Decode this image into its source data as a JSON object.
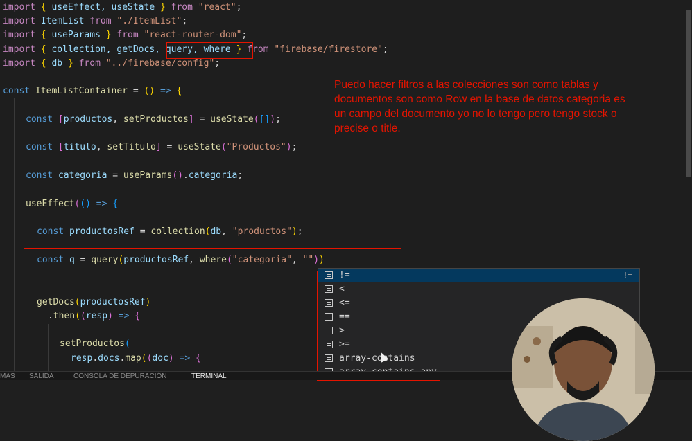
{
  "code": {
    "l1": {
      "kw_import": "import",
      "b_open": "{",
      "names": " useEffect, useState ",
      "b_close": "}",
      "kw_from": "from",
      "src": "\"react\"",
      "semi": ";"
    },
    "l2": {
      "kw_import": "import",
      "name": "ItemList",
      "kw_from": "from",
      "src": "\"./ItemList\"",
      "semi": ";"
    },
    "l3": {
      "kw_import": "import",
      "b_open": "{",
      "names": " useParams ",
      "b_close": "}",
      "kw_from": "from",
      "src": "\"react-router-dom\"",
      "semi": ";"
    },
    "l4": {
      "kw_import": "import",
      "b_open": "{",
      "names_a": " collection, getDocs, ",
      "names_b": "query, where ",
      "b_close": "}",
      "kw_from": "from",
      "src": "\"firebase/firestore\"",
      "semi": ";"
    },
    "l5": {
      "kw_import": "import",
      "b_open": "{",
      "names": " db ",
      "b_close": "}",
      "kw_from": "from",
      "src": "\"../firebase/config\"",
      "semi": ";"
    },
    "l6": {
      "kw_const": "const",
      "name": "ItemListContainer",
      "eq": " = ",
      "parens": "()",
      "arrow": " => ",
      "brace": "{"
    },
    "l7": {
      "kw_const": "const",
      "lb": "[",
      "a": "productos",
      "comma": ", ",
      "b": "setProductos",
      "rb": "]",
      "eq": " = ",
      "fn": "useState",
      "lp": "(",
      "arr": "[]",
      "rp": ")",
      "semi": ";"
    },
    "l8": {
      "kw_const": "const",
      "lb": "[",
      "a": "titulo",
      "comma": ", ",
      "b": "setTitulo",
      "rb": "]",
      "eq": " = ",
      "fn": "useState",
      "lp": "(",
      "str": "\"Productos\"",
      "rp": ")",
      "semi": ";"
    },
    "l9": {
      "kw_const": "const",
      "name": "categoria",
      "eq": " = ",
      "fn": "useParams",
      "call": "()",
      "dot": ".",
      "prop": "categoria",
      "semi": ";"
    },
    "l10": {
      "fn": "useEffect",
      "lp": "(",
      "parens": "()",
      "arrow": " => ",
      "brace": "{"
    },
    "l11": {
      "kw_const": "const",
      "name": "productosRef",
      "eq": " = ",
      "fn": "collection",
      "lp": "(",
      "arg": "db",
      "comma": ", ",
      "str": "\"productos\"",
      "rp": ")",
      "semi": ";"
    },
    "l12": {
      "kw_const": "const",
      "name": "q",
      "eq": " = ",
      "fn": "query",
      "lp": "(",
      "arg": "productosRef",
      "comma": ", ",
      "fn2": "where",
      "lp2": "(",
      "str1": "\"categoria\"",
      "comma2": ", ",
      "str2": "\"\"",
      "rp2": ")",
      "rp": ")"
    },
    "l13": {
      "fn": "getDocs",
      "lp": "(",
      "arg": "productosRef",
      "rp": ")"
    },
    "l14": {
      "dot": ".",
      "fn": "then",
      "lp": "(",
      "lp2": "(",
      "arg": "resp",
      "rp2": ")",
      "arrow": " => ",
      "brace": "{"
    },
    "l15": {
      "fn": "setProductos",
      "lp": "("
    },
    "l16": {
      "obj": "resp",
      "dot1": ".",
      "prop": "docs",
      "dot2": ".",
      "fn": "map",
      "lp": "(",
      "lp2": "(",
      "arg": "doc",
      "rp2": ")",
      "arrow": " => ",
      "brace": "{"
    }
  },
  "annotation": "Puedo hacer filtros a las colecciones son como tablas y documentos son como Row en la base de datos categoria es un campo del documento yo no lo tengo pero tengo stock o precise o title.",
  "suggest": {
    "items": [
      "!=",
      "<",
      "<=",
      "==",
      ">",
      ">=",
      "array-contains",
      "array-contains-any"
    ],
    "hint": "!="
  },
  "panel": {
    "tabs": [
      "MAS",
      "SALIDA",
      "CONSOLA DE DEPURACIÓN",
      "TERMINAL"
    ]
  },
  "colors": {
    "keyword": "#c586c0",
    "storage": "#569cd6",
    "variable": "#9cdcfe",
    "function": "#dcdcaa",
    "string": "#ce9178",
    "annotation": "#e51400",
    "selection": "#04395e"
  }
}
